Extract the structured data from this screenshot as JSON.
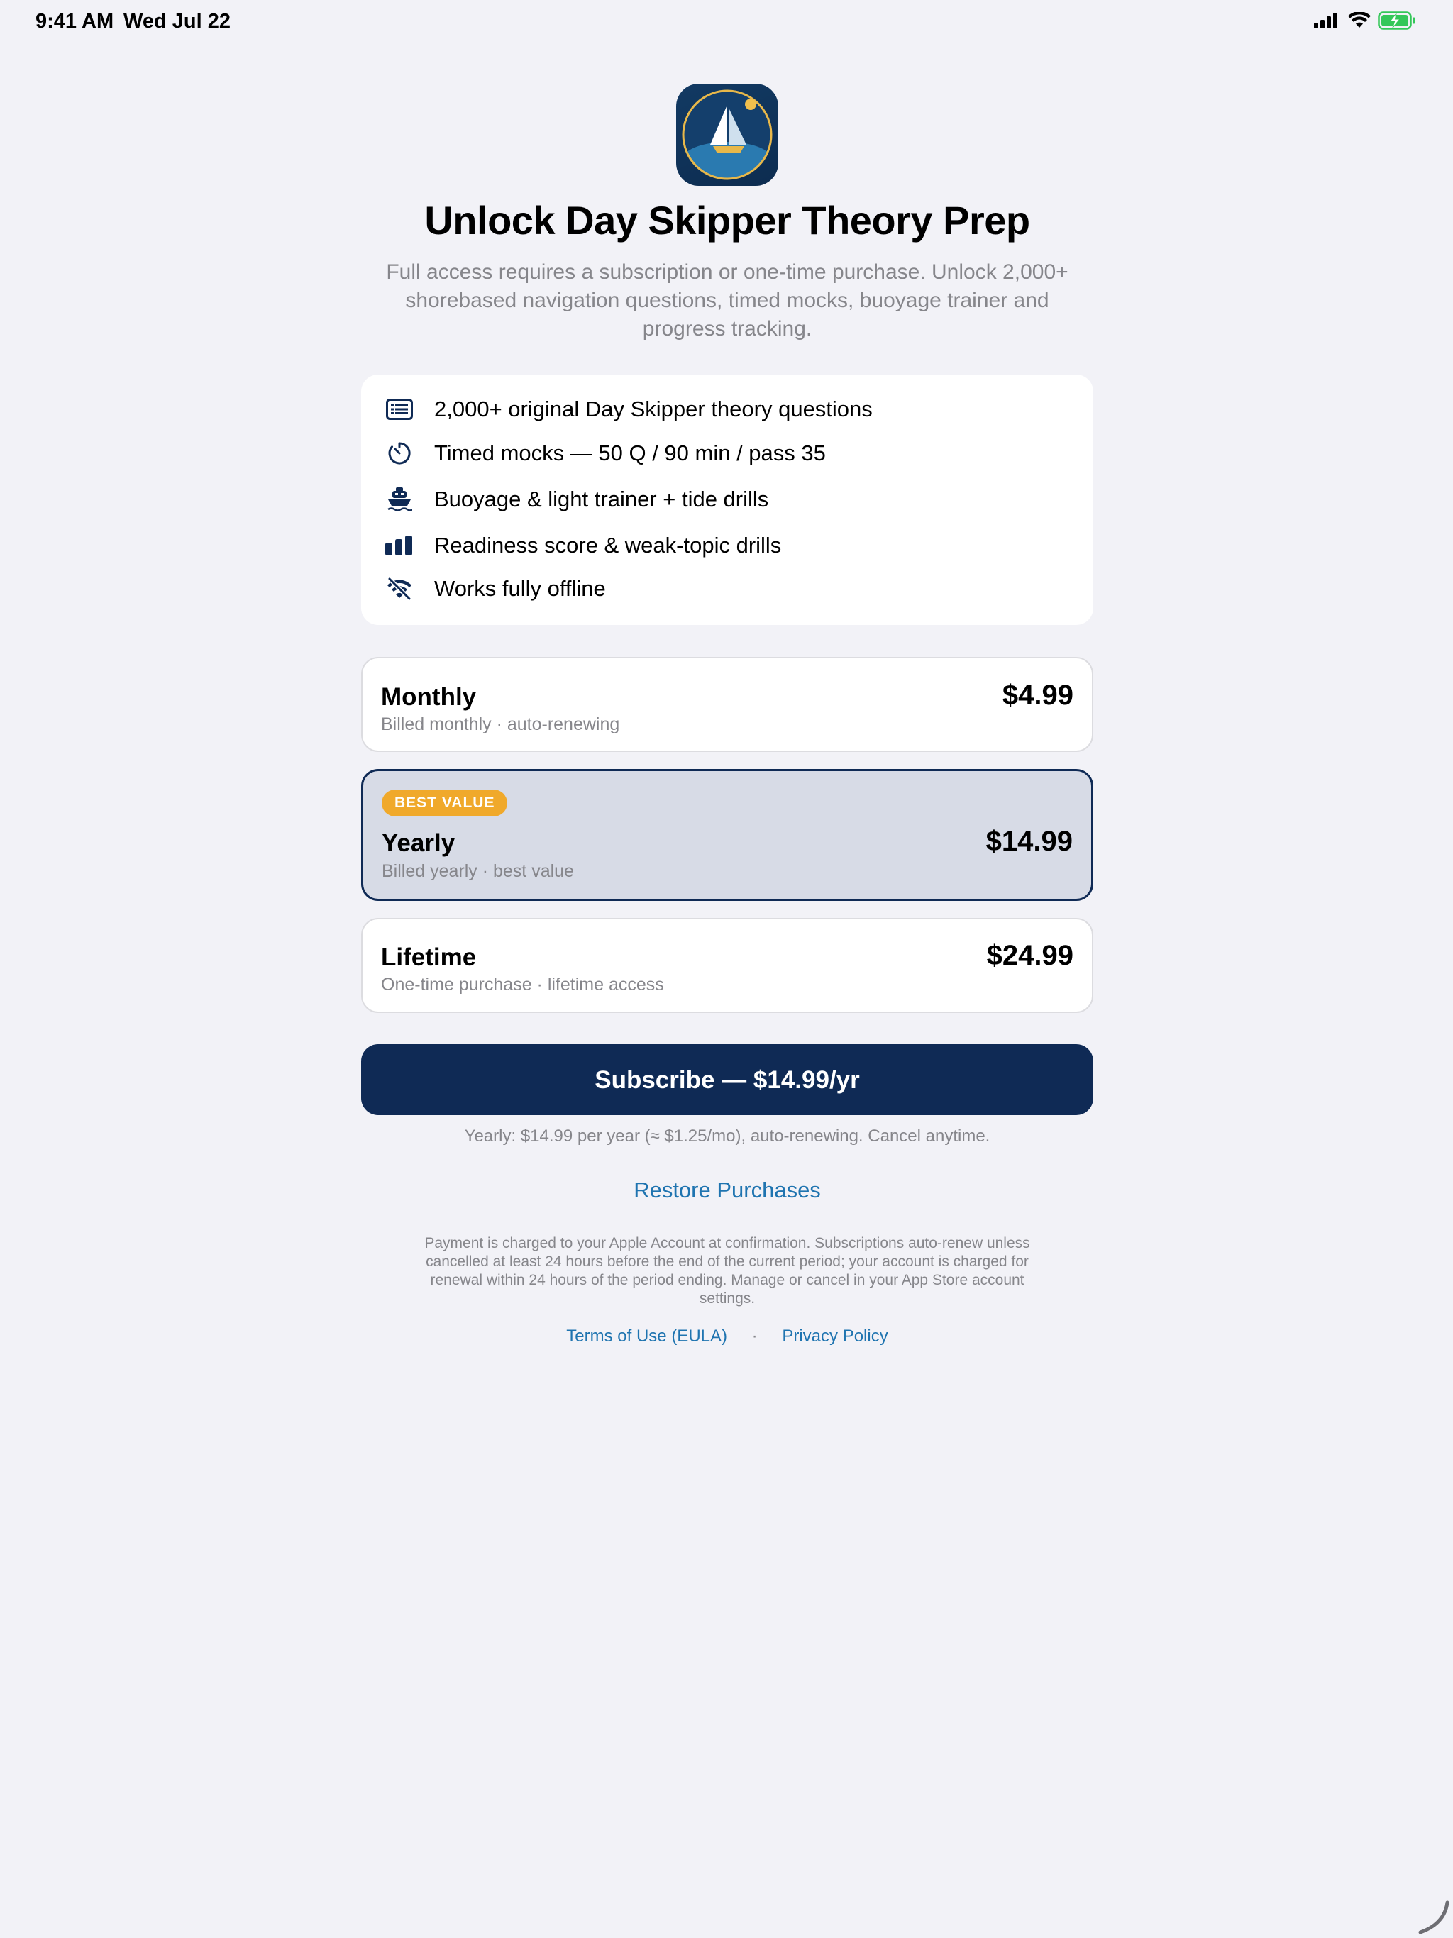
{
  "status_bar": {
    "time": "9:41 AM",
    "date": "Wed Jul 22",
    "icons": [
      "cellular-signal-icon",
      "wifi-icon",
      "battery-charging-icon"
    ]
  },
  "header": {
    "app_icon": "sailboat-app-icon",
    "title": "Unlock Day Skipper Theory Prep",
    "subtitle_lines": [
      "Full access requires a subscription or one-time purchase. Unlock 2,000+",
      "shorebased navigation questions, timed mocks, buoyage trainer and",
      "progress tracking."
    ]
  },
  "features": [
    {
      "icon": "list-document-icon",
      "text": "2,000+ original Day Skipper theory questions"
    },
    {
      "icon": "timer-icon",
      "text": "Timed mocks — 50 Q / 90 min / pass 35"
    },
    {
      "icon": "ferry-icon",
      "text": "Buoyage & light trainer + tide drills"
    },
    {
      "icon": "bar-chart-icon",
      "text": "Readiness score & weak-topic drills"
    },
    {
      "icon": "wifi-slash-icon",
      "text": "Works fully offline"
    }
  ],
  "plans": [
    {
      "name": "Monthly",
      "desc": "Billed monthly · auto-renewing",
      "price": "$4.99",
      "selected": false
    },
    {
      "name": "Yearly",
      "desc": "Billed yearly · best value",
      "price": "$14.99",
      "selected": true,
      "badge": "BEST VALUE"
    },
    {
      "name": "Lifetime",
      "desc": "One-time purchase · lifetime access",
      "price": "$24.99",
      "selected": false
    }
  ],
  "cta": {
    "subscribe_label": "Subscribe — $14.99/yr",
    "billing_note": "Yearly: $14.99 per year (≈ $1.25/mo), auto-renewing. Cancel anytime.",
    "restore_label": "Restore Purchases"
  },
  "legal": {
    "lines": [
      "Payment is charged to your Apple Account at confirmation. Subscriptions auto-renew unless",
      "cancelled at least 24 hours before the end of the current period; your account is charged for",
      "renewal within 24 hours of the period ending. Manage or cancel in your App Store account",
      "settings."
    ],
    "terms_label": "Terms of Use (EULA)",
    "separator": "·",
    "privacy_label": "Privacy Policy"
  },
  "colors": {
    "background": "#f2f2f7",
    "accent_navy": "#0f2a55",
    "link_blue": "#1f74b0",
    "badge_orange": "#f0a92b",
    "selected_plan_bg": "#d7dbe6",
    "secondary_text": "#86868b"
  }
}
